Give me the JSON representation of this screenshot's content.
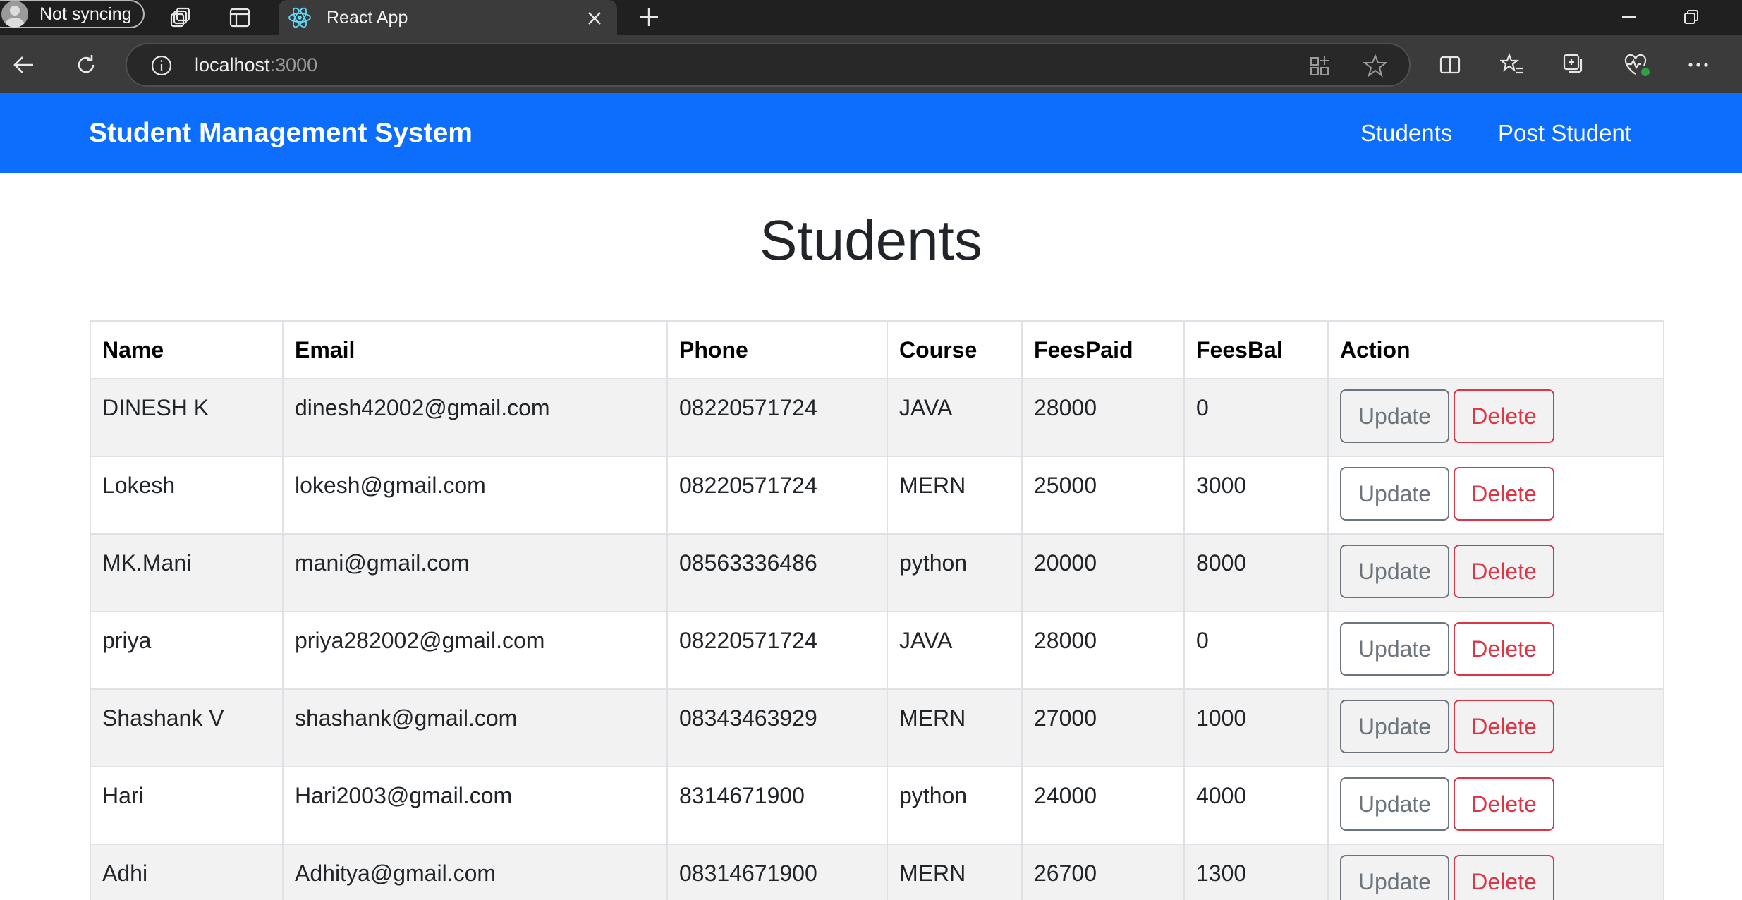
{
  "browser": {
    "profile_label": "Not syncing",
    "tab_title": "React App",
    "url_host": "localhost",
    "url_port": ":3000",
    "icons": {
      "profile": "profile-avatar-icon",
      "workspaces": "workspaces-icon",
      "tab_actions": "tab-actions-icon",
      "react_favicon": "react-atom-icon",
      "close_tab": "close-icon",
      "new_tab": "plus-icon",
      "minimize": "minimize-icon",
      "restore": "restore-icon",
      "back": "back-arrow-icon",
      "refresh": "refresh-icon",
      "site_info": "info-icon",
      "app_available": "app-grid-icon",
      "favorite": "star-icon",
      "split_screen": "split-screen-icon",
      "favorites": "favorites-list-icon",
      "collections": "collections-icon",
      "browser_essentials": "heart-pulse-icon",
      "more": "more-dots-icon"
    }
  },
  "navbar": {
    "brand": "Student Management System",
    "links": [
      "Students",
      "Post Student"
    ],
    "background_color": "#0d6efd"
  },
  "page": {
    "title": "Students"
  },
  "table": {
    "headers": [
      "Name",
      "Email",
      "Phone",
      "Course",
      "FeesPaid",
      "FeesBal",
      "Action"
    ],
    "rows": [
      {
        "name": "DINESH K",
        "email": "dinesh42002@gmail.com",
        "phone": "08220571724",
        "course": "JAVA",
        "fees_paid": "28000",
        "fees_bal": "0"
      },
      {
        "name": "Lokesh",
        "email": "lokesh@gmail.com",
        "phone": "08220571724",
        "course": "MERN",
        "fees_paid": "25000",
        "fees_bal": "3000"
      },
      {
        "name": "MK.Mani",
        "email": "mani@gmail.com",
        "phone": "08563336486",
        "course": "python",
        "fees_paid": "20000",
        "fees_bal": "8000"
      },
      {
        "name": "priya",
        "email": "priya282002@gmail.com",
        "phone": "08220571724",
        "course": "JAVA",
        "fees_paid": "28000",
        "fees_bal": "0"
      },
      {
        "name": "Shashank V",
        "email": "shashank@gmail.com",
        "phone": "08343463929",
        "course": "MERN",
        "fees_paid": "27000",
        "fees_bal": "1000"
      },
      {
        "name": "Hari",
        "email": "Hari2003@gmail.com",
        "phone": "8314671900",
        "course": "python",
        "fees_paid": "24000",
        "fees_bal": "4000"
      },
      {
        "name": "Adhi",
        "email": "Adhitya@gmail.com",
        "phone": "08314671900",
        "course": "MERN",
        "fees_paid": "26700",
        "fees_bal": "1300"
      }
    ],
    "update_label": "Update",
    "delete_label": "Delete",
    "update_color": "#6c757d",
    "delete_color": "#dc3545"
  }
}
